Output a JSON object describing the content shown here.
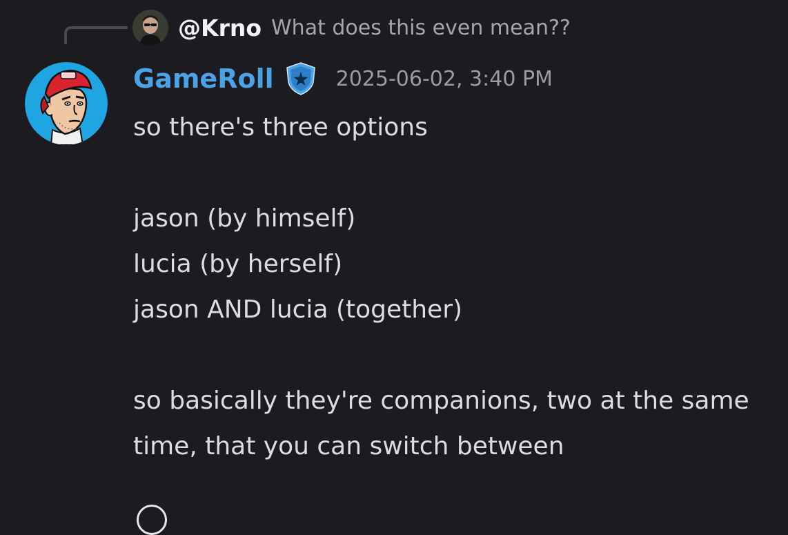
{
  "reply": {
    "author": "@Krno",
    "preview": "What does this even mean??",
    "avatar_icon": "user-avatar-sunglasses"
  },
  "message": {
    "author": "GameRoll",
    "author_color": "#4aa3e8",
    "badge_icon": "police-shield-star-badge",
    "timestamp": "2025-06-02, 3:40 PM",
    "avatar_icon": "cartoon-man-red-cap-avatar",
    "lines": {
      "l1": "so there's three options",
      "l2": "jason (by himself)",
      "l3": "lucia (by herself)",
      "l4": "jason AND lucia (together)",
      "l5": "so basically they're companions, two at the same time, that you can switch between"
    }
  }
}
